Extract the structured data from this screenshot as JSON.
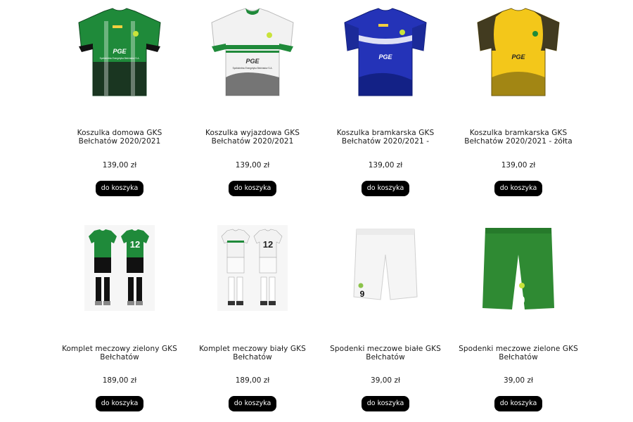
{
  "products": [
    {
      "name": "Koszulka domowa GKS Bełchatów 2020/2021",
      "price": "139,00 zł",
      "button": "do koszyka",
      "sponsor": "PGE",
      "sponsor_sub": "Spółdzielnia Energetyka Bełchatów S.A.",
      "colors": {
        "main": "#1f8a3a",
        "accent": "#111111",
        "trim": "#ffffff"
      }
    },
    {
      "name": "Koszulka wyjazdowa GKS Bełchatów 2020/2021",
      "price": "139,00 zł",
      "button": "do koszyka",
      "sponsor": "PGE",
      "sponsor_sub": "Spółdzielnia Energetyka Bełchatów S.A.",
      "colors": {
        "main": "#f2f2f2",
        "accent": "#1f8a3a",
        "trim": "#444444"
      }
    },
    {
      "name": "Koszulka bramkarska GKS Bełchatów 2020/2021 -",
      "price": "139,00 zł",
      "button": "do koszyka",
      "sponsor": "PGE",
      "colors": {
        "main": "#2433b8",
        "accent": "#ffffff",
        "trim": "#0d1a70"
      }
    },
    {
      "name": "Koszulka bramkarska GKS Bełchatów 2020/2021 - żółta",
      "price": "139,00 zł",
      "button": "do koszyka",
      "sponsor": "PGE",
      "colors": {
        "main": "#f3c71a",
        "accent": "#222222",
        "trim": "#6d5a10"
      }
    },
    {
      "name": "Komplet meczowy zielony GKS Bełchatów",
      "price": "189,00 zł",
      "button": "do koszyka",
      "number": "12",
      "colors": {
        "main": "#1f8a3a",
        "accent": "#111111"
      }
    },
    {
      "name": "Komplet meczowy biały GKS Bełchatów",
      "price": "189,00 zł",
      "button": "do koszyka",
      "number": "12",
      "colors": {
        "main": "#f2f2f2",
        "accent": "#1f8a3a"
      }
    },
    {
      "name": "Spodenki meczowe białe GKS Bełchatów",
      "price": "39,00 zł",
      "button": "do koszyka",
      "number": "9",
      "colors": {
        "main": "#f5f5f5",
        "accent": "#111111"
      }
    },
    {
      "name": "Spodenki meczowe zielone GKS Bełchatów",
      "price": "39,00 zł",
      "button": "do koszyka",
      "number": "9",
      "colors": {
        "main": "#2f8a33",
        "accent": "#ffffff"
      }
    }
  ]
}
